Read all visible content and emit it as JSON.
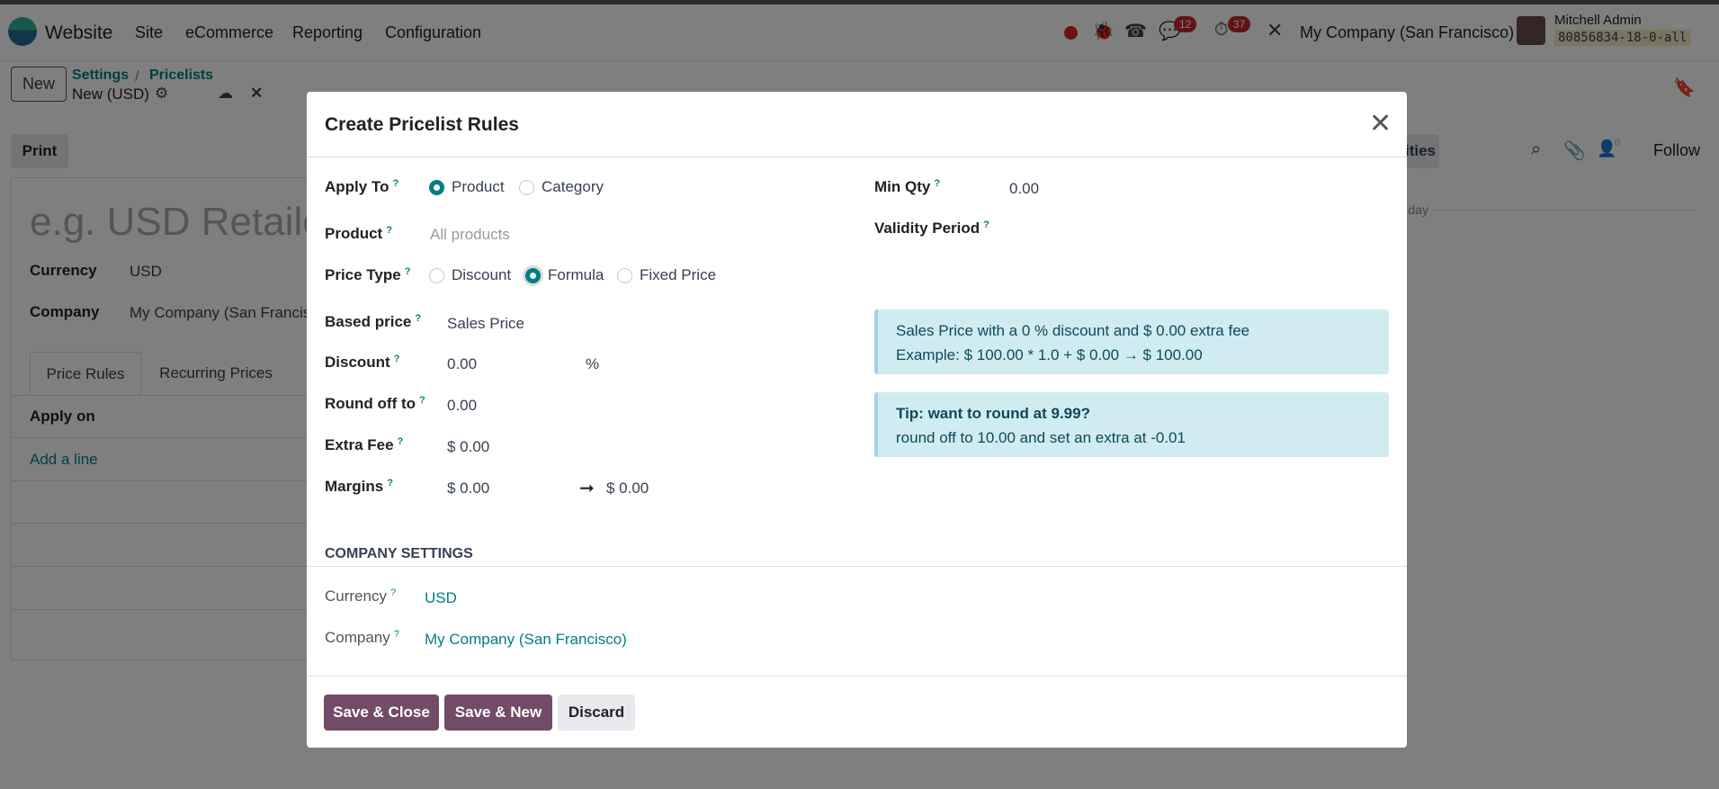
{
  "navbar": {
    "app": "Website",
    "menu": [
      "Site",
      "eCommerce",
      "Reporting",
      "Configuration"
    ],
    "badges": {
      "messages": "12",
      "activities": "37"
    },
    "company": "My Company (San Francisco)",
    "user": "Mitchell Admin",
    "db": "80856834-18-0-all"
  },
  "control": {
    "new": "New",
    "breadcrumb": [
      "Settings",
      "Pricelists"
    ],
    "record": "New (USD)",
    "print": "Print"
  },
  "form": {
    "name_placeholder": "e.g. USD Retailer",
    "currency_label": "Currency",
    "currency": "USD",
    "company_label": "Company",
    "company": "My Company (San Francisco)",
    "tabs": [
      "Price Rules",
      "Recurring Prices"
    ],
    "col_apply_on": "Apply on",
    "add_line": "Add a line"
  },
  "chatter": {
    "activities": "Activities",
    "follow": "Follow",
    "followers": "0",
    "today": "Today"
  },
  "modal": {
    "title": "Create Pricelist Rules",
    "apply_to": {
      "label": "Apply To",
      "options": [
        "Product",
        "Category"
      ],
      "selected": "Product"
    },
    "product": {
      "label": "Product",
      "placeholder": "All products"
    },
    "price_type": {
      "label": "Price Type",
      "options": [
        "Discount",
        "Formula",
        "Fixed Price"
      ],
      "selected": "Formula"
    },
    "based_price": {
      "label": "Based price",
      "value": "Sales Price"
    },
    "discount": {
      "label": "Discount",
      "value": "0.00",
      "unit": "%"
    },
    "round_off": {
      "label": "Round off to",
      "value": "0.00"
    },
    "extra_fee": {
      "label": "Extra Fee",
      "value": "$ 0.00"
    },
    "margins": {
      "label": "Margins",
      "min": "$ 0.00",
      "max": "$ 0.00"
    },
    "min_qty": {
      "label": "Min Qty",
      "value": "0.00"
    },
    "validity": {
      "label": "Validity Period"
    },
    "info": {
      "line1": "Sales Price with a 0 % discount and $ 0.00 extra fee",
      "line2": "Example: $ 100.00 * 1.0 + $ 0.00 → $ 100.00"
    },
    "tip": {
      "title": "Tip: want to round at 9.99?",
      "text": "round off to 10.00 and set an extra at -0.01"
    },
    "company_settings": "COMPANY SETTINGS",
    "currency": {
      "label": "Currency",
      "value": "USD"
    },
    "company": {
      "label": "Company",
      "value": "My Company (San Francisco)"
    },
    "buttons": {
      "save_close": "Save & Close",
      "save_new": "Save & New",
      "discard": "Discard"
    }
  }
}
